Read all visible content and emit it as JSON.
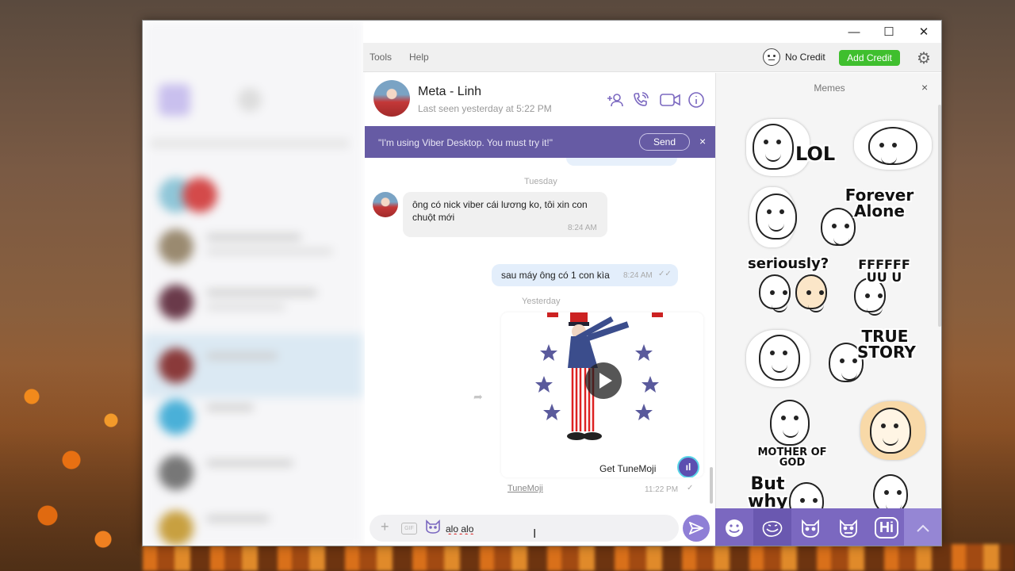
{
  "window": {
    "menu": [
      "Tools",
      "Help"
    ],
    "controls": {
      "minimize": "—",
      "maximize": "☐",
      "close": "✕"
    }
  },
  "credit": {
    "no_credit_label": "No Credit",
    "add_credit_label": "Add Credit",
    "accent": "#3fbf2e"
  },
  "chat": {
    "contact_name": "Meta - Linh",
    "last_seen": "Last seen yesterday at 5:22 PM",
    "invite_text": "\"I'm using Viber Desktop. You must try it!\"",
    "invite_send": "Send",
    "invite_close": "×",
    "day_tuesday": "Tuesday",
    "day_yesterday": "Yesterday",
    "incoming": {
      "text": "ông có nick viber cái lương ko, tôi xin con chuột mới",
      "time": "8:24 AM"
    },
    "outgoing": {
      "text": "sau máy ông có 1 con kìa",
      "time": "8:24 AM",
      "status": "✓✓"
    },
    "video": {
      "cta": "Get TuneMoji",
      "badge": "ıl",
      "link": "TuneMoji",
      "time": "11:22 PM",
      "status": "✓"
    },
    "composer_value": "alo alo",
    "brand_color": "#7b68c0"
  },
  "memes": {
    "title": "Memes",
    "close": "×",
    "items": [
      {
        "caption": "LOL"
      },
      {
        "caption": ""
      },
      {
        "caption": "Forever Alone"
      },
      {
        "caption": ""
      },
      {
        "caption": "seriously?"
      },
      {
        "caption": "FFFFFF UU U"
      },
      {
        "caption": ""
      },
      {
        "caption": "TRUE STORY"
      },
      {
        "caption": "MOTHER OF GOD"
      },
      {
        "caption": ""
      },
      {
        "caption": "But why"
      },
      {
        "caption": ""
      }
    ]
  },
  "sticker_tabs": [
    "emoji-icon",
    "troll-face-icon",
    "cat-icon",
    "cat-tet-icon",
    "hi-icon"
  ],
  "sticker_tab_hi": "Hi"
}
